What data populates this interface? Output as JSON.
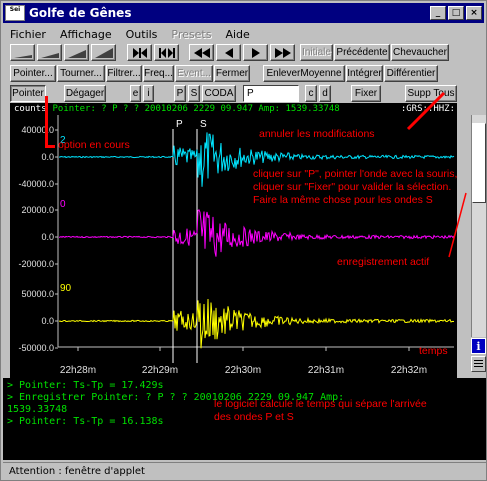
{
  "window": {
    "title": "Golfe de Gênes",
    "appicon": "Sei",
    "min": "_",
    "max": "□",
    "close": "×"
  },
  "menu": [
    "Fichier",
    "Affichage",
    "Outils",
    "Presets",
    "Aide"
  ],
  "toolbar1": {
    "initiale": "Initiale",
    "precedente": "Précédente",
    "chevaucher": "Chevaucher"
  },
  "toolbar2": [
    "Pointer...",
    "Tourner...",
    "Filtrer...",
    "Freq...",
    "Event...",
    "Fermer",
    "EnleverMoyenne",
    "Intégrer",
    "Différentier"
  ],
  "toolbar3": {
    "pointer": "Pointer",
    "degager": "Dégager",
    "e": "e",
    "i": "i",
    "p": "P",
    "s": "S",
    "coda": "CODA",
    "input_value": "P",
    "c": "c",
    "d": "d",
    "fixer": "Fixer",
    "supp_tous": "Supp Tous"
  },
  "infoline": {
    "counts": "counts",
    "pick": "Pointer: ? P ? ? 20010206 2229 09.947  Amp: 1539.33748",
    "channel": ":GRS::HHZ:"
  },
  "plot": {
    "phase_p": "P",
    "phase_s": "S",
    "ylabels": [
      "40000.0",
      "0.0",
      "-40000.0",
      "20000.0",
      "0.0",
      "-20000.0",
      "50000.0",
      "0.0",
      "-50000.0"
    ],
    "traces": [
      {
        "label": "2",
        "color": "#00e5ff"
      },
      {
        "label": "0",
        "color": "#ff00ff"
      },
      {
        "label": "90",
        "color": "#ffff00"
      }
    ],
    "xlabels": [
      "22h28m",
      "22h29m",
      "22h30m",
      "22h31m",
      "22h32m"
    ]
  },
  "console": [
    "> Pointer: Ts-Tp = 17.429s",
    "> Enregistrer Pointer: ? P ? ? 20010206 2229 09.947  Amp:",
    "1539.33748",
    "> Pointer: Ts-Tp = 16.138s"
  ],
  "status": "Attention : fenêtre d'applet",
  "annotations": {
    "option": "option en cours",
    "annuler": "annuler les modifications",
    "instructions": "cliquer sur \"P\", pointer l'onde avec la souris, cliquer sur \"Fixer\" pour valider la sélection. Faire la même chose pour les ondes S",
    "enregistrement": "enregistrement actif",
    "temps": "temps",
    "logiciel": "le logiciel calcule le temps qui sépare l'arrivée des ondes P et S"
  },
  "colors": {
    "title_bar": "#000080",
    "annotation": "#ff0000",
    "console_text": "#00e000"
  }
}
